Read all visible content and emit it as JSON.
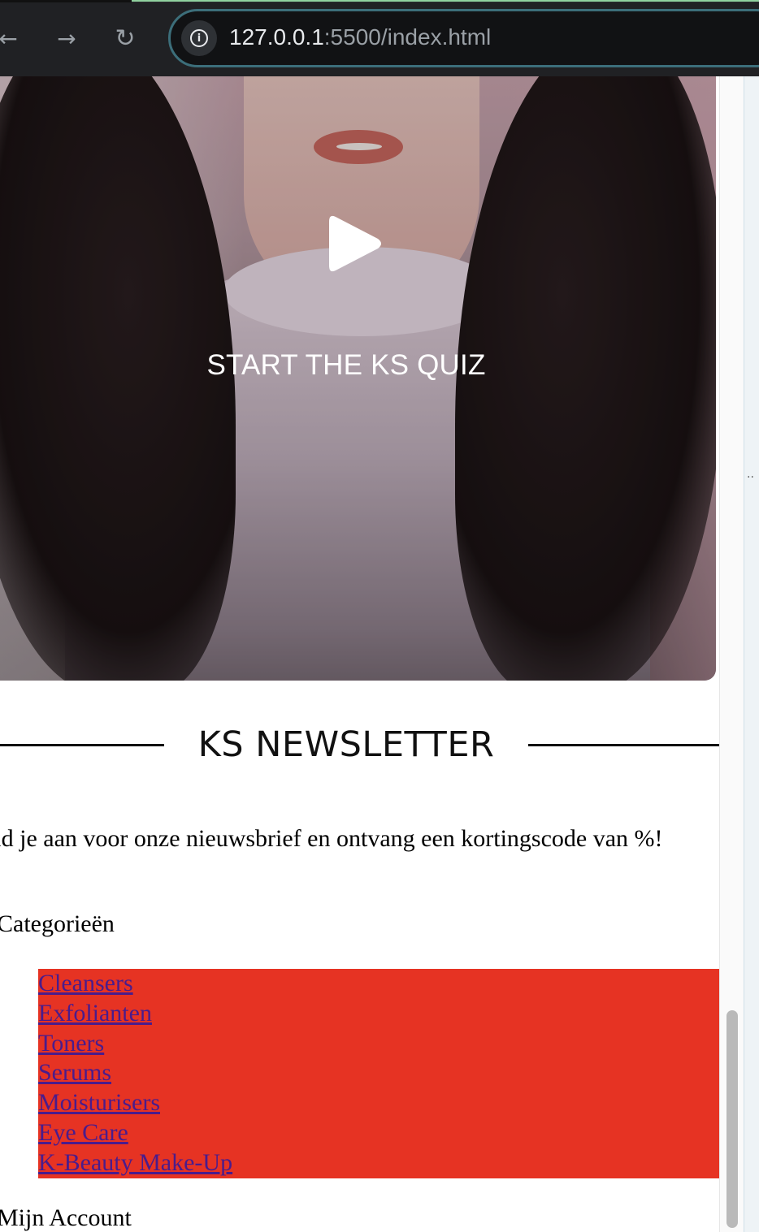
{
  "browser": {
    "url_host": "127.0.0.1",
    "url_rest": ":5500/index.html"
  },
  "icons": {
    "back": "back-arrow-icon",
    "forward": "forward-arrow-icon",
    "reload": "reload-icon",
    "site_info": "info-icon",
    "play": "play-icon"
  },
  "video": {
    "cta_label": "START THE KS QUIZ"
  },
  "newsletter": {
    "title": "KS NEWSLETTER",
    "promo_text": "eld je aan voor onze nieuwsbrief en ontvang een kortingscode van %!"
  },
  "categories": {
    "heading": "Categorieën",
    "items": [
      {
        "label": "Cleansers"
      },
      {
        "label": "Exfolianten"
      },
      {
        "label": "Toners"
      },
      {
        "label": "Serums"
      },
      {
        "label": "Moisturisers"
      },
      {
        "label": "Eye Care"
      },
      {
        "label": "K-Beauty Make-Up"
      }
    ]
  },
  "account": {
    "heading": "Mijn Account"
  },
  "colors": {
    "category_background": "#e63323",
    "link": "#4a1c8c",
    "omnibox_border": "#3c6e7a"
  }
}
